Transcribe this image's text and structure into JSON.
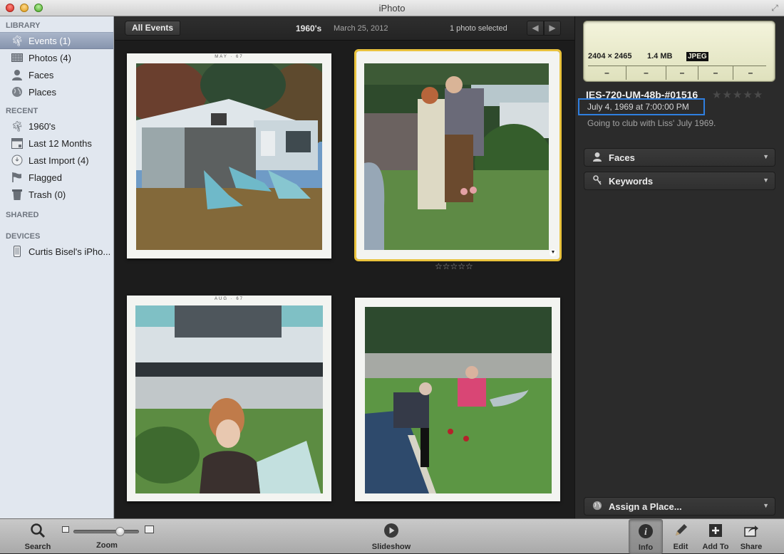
{
  "window": {
    "title": "iPhoto"
  },
  "sidebar": {
    "sections": [
      {
        "title": "LIBRARY",
        "items": [
          {
            "label": "Events (1)",
            "icon": "events-palm-icon",
            "selected": true
          },
          {
            "label": "Photos (4)",
            "icon": "photos-grid-icon"
          },
          {
            "label": "Faces",
            "icon": "faces-person-icon"
          },
          {
            "label": "Places",
            "icon": "places-globe-icon"
          }
        ]
      },
      {
        "title": "RECENT",
        "items": [
          {
            "label": "1960's",
            "icon": "event-palm-icon"
          },
          {
            "label": "Last 12 Months",
            "icon": "calendar-icon"
          },
          {
            "label": "Last Import (4)",
            "icon": "import-clock-icon"
          },
          {
            "label": "Flagged",
            "icon": "flag-icon"
          },
          {
            "label": "Trash (0)",
            "icon": "trash-icon"
          }
        ]
      },
      {
        "title": "SHARED",
        "items": []
      },
      {
        "title": "DEVICES",
        "items": [
          {
            "label": "Curtis Bisel's iPho...",
            "icon": "iphone-icon"
          }
        ]
      }
    ]
  },
  "header": {
    "back_button": "All Events",
    "event_title": "1960's",
    "event_date": "March 25, 2012",
    "selection_status": "1 photo selected",
    "prev_icon": "arrow-left-icon",
    "next_icon": "arrow-right-icon"
  },
  "photos": [
    {
      "stamp": "MAY · 67",
      "description": "trailer with lawn chairs",
      "selected": false
    },
    {
      "stamp": "",
      "description": "couple standing in yard",
      "selected": true,
      "rating": "☆☆☆☆☆"
    },
    {
      "stamp": "AUG · 67",
      "description": "woman seated in lawn chair",
      "selected": false
    },
    {
      "stamp": "",
      "description": "two men seated in yard",
      "selected": false
    }
  ],
  "info": {
    "dimensions": "2404 × 2465",
    "file_size": "1.4 MB",
    "format": "JPEG",
    "exif": [
      "–",
      "–",
      "–",
      "–",
      "–"
    ],
    "name": "IES-720-UM-48b-#01516",
    "rating": "★★★★★",
    "datetime": "July 4, 1969 at 7:00:00 PM",
    "description": "Going to club with Liss' July 1969.",
    "faces_label": "Faces",
    "keywords_label": "Keywords",
    "place_label": "Assign a Place...",
    "accent_color": "#2f7fe0",
    "selection_color": "#e9c23d"
  },
  "toolbar": {
    "search": "Search",
    "zoom": "Zoom",
    "zoom_level": 0.75,
    "slideshow": "Slideshow",
    "info": "Info",
    "edit": "Edit",
    "add_to": "Add To",
    "share": "Share"
  }
}
